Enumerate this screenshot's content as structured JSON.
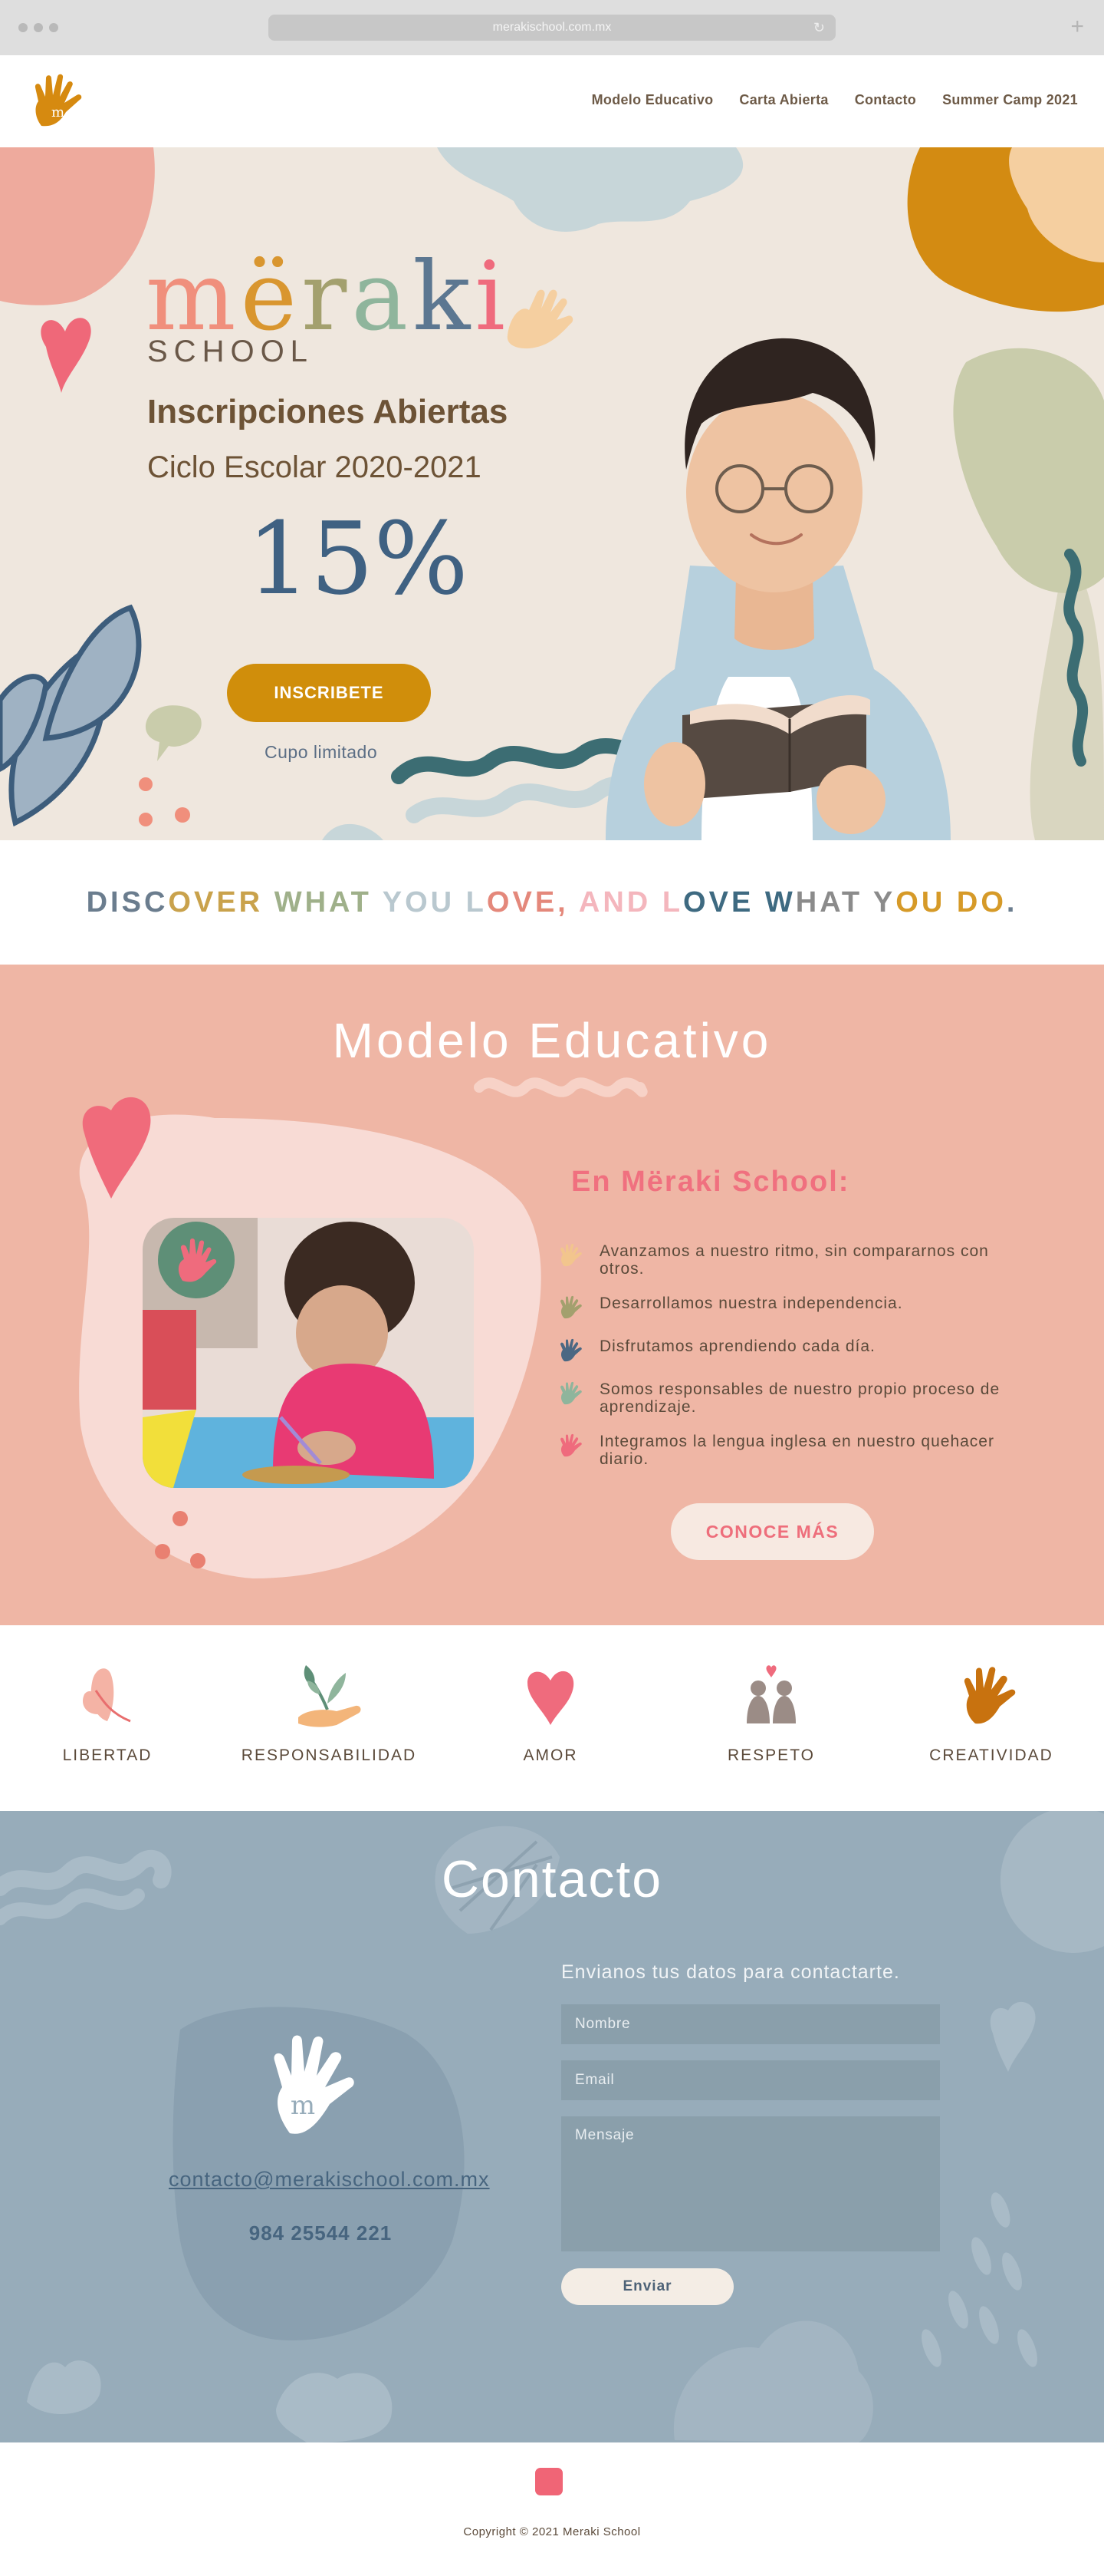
{
  "browser": {
    "url": "merakischool.com.mx"
  },
  "nav": {
    "logo_letter": "m",
    "items": [
      {
        "label": "Modelo Educativo"
      },
      {
        "label": "Carta Abierta"
      },
      {
        "label": "Contacto"
      },
      {
        "label": "Summer Camp 2021"
      }
    ]
  },
  "hero": {
    "brand_letters": [
      {
        "char": "m",
        "color": "#f08f7c"
      },
      {
        "char": "ë",
        "color": "#d9962f"
      },
      {
        "char": "r",
        "color": "#a3a06e"
      },
      {
        "char": "a",
        "color": "#8fb59c"
      },
      {
        "char": "k",
        "color": "#5c7791"
      },
      {
        "char": "i",
        "color": "#ef6b7d"
      }
    ],
    "school": "SCHOOL",
    "title": "Inscripciones Abiertas",
    "subtitle": "Ciclo Escolar 2020-2021",
    "discount": "15%",
    "cta": "INSCRIBETE",
    "limited": "Cupo limitado"
  },
  "motto": {
    "text": "DISCOVER WHAT YOU LOVE, AND LOVE WHAT YOU DO.",
    "colors": [
      "#6b7d8e",
      "#c9a24c",
      "#9fb08a",
      "#b9c8cf",
      "#e4887b",
      "#f4b6bd",
      "#3e6a81",
      "#8b8b8b",
      "#d69a28"
    ]
  },
  "modelo": {
    "title": "Modelo Educativo",
    "subtitle": "En Mëraki School:",
    "items": [
      {
        "text": "Avanzamos a nuestro ritmo, sin compararnos con otros.",
        "color": "#f2c58d"
      },
      {
        "text": "Desarrollamos nuestra independencia.",
        "color": "#a3a06e"
      },
      {
        "text": "Disfrutamos aprendiendo cada día.",
        "color": "#4b6883"
      },
      {
        "text": "Somos responsables de nuestro propio proceso de aprendizaje.",
        "color": "#8fb59c"
      },
      {
        "text": "Integramos la lengua inglesa en nuestro quehacer diario.",
        "color": "#ef6b7d"
      }
    ],
    "button": "CONOCE MÁS"
  },
  "values": [
    {
      "label": "LIBERTAD",
      "icon": "butterfly-icon"
    },
    {
      "label": "RESPONSABILIDAD",
      "icon": "plant-hand-icon"
    },
    {
      "label": "AMOR",
      "icon": "heart-icon"
    },
    {
      "label": "RESPETO",
      "icon": "couple-icon"
    },
    {
      "label": "CREATIVIDAD",
      "icon": "hand-icon"
    }
  ],
  "contacto": {
    "title": "Contacto",
    "email": "contacto@merakischool.com.mx",
    "phone": "984 25544 221",
    "form_title": "Envianos tus datos para contactarte.",
    "name_placeholder": "Nombre",
    "email_placeholder": "Email",
    "message_placeholder": "Mensaje",
    "send": "Enviar"
  },
  "footer": {
    "copyright": "Copyright © 2021 Meraki School"
  }
}
